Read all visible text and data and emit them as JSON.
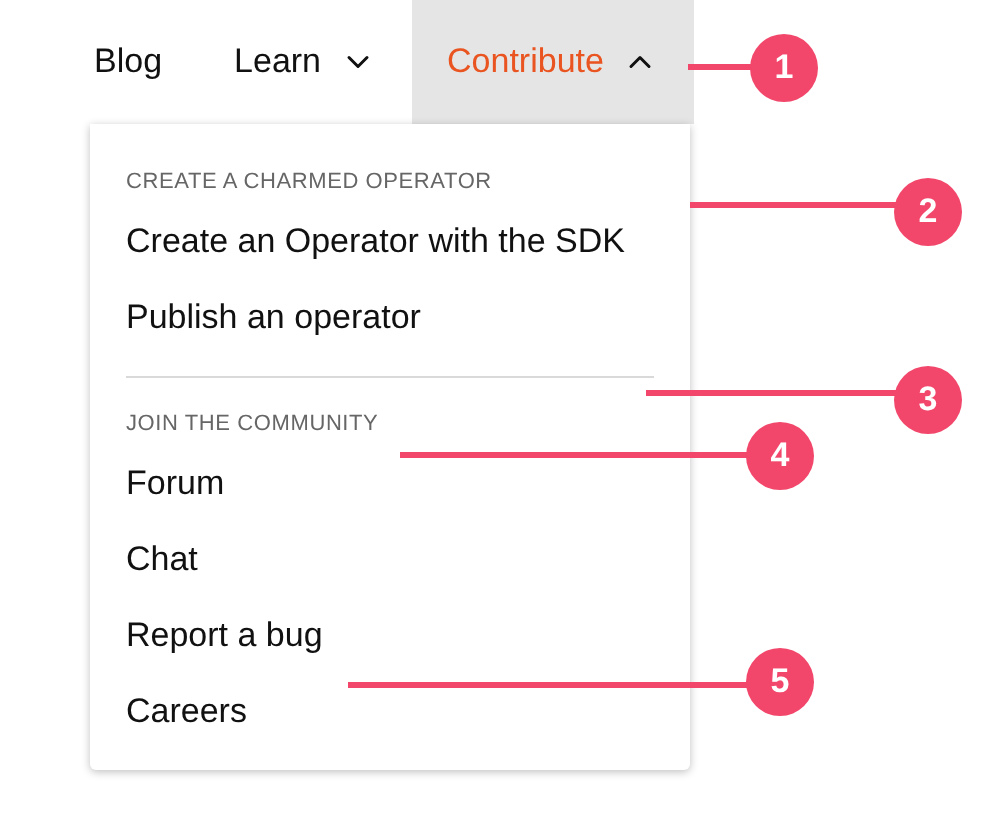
{
  "nav": [
    {
      "label": "Blog",
      "kind": "link"
    },
    {
      "label": "Learn",
      "kind": "dropdown",
      "expanded": false
    },
    {
      "label": "Contribute",
      "kind": "dropdown",
      "expanded": true
    }
  ],
  "menu": {
    "sections": [
      {
        "heading": "CREATE A CHARMED OPERATOR",
        "items": [
          "Create an Operator with the SDK",
          "Publish an operator"
        ]
      },
      {
        "heading": "JOIN THE COMMUNITY",
        "items": [
          "Forum",
          "Chat",
          "Report a bug",
          "Careers"
        ]
      }
    ]
  },
  "callouts": [
    {
      "number": "1"
    },
    {
      "number": "2"
    },
    {
      "number": "3"
    },
    {
      "number": "4"
    },
    {
      "number": "5"
    }
  ]
}
